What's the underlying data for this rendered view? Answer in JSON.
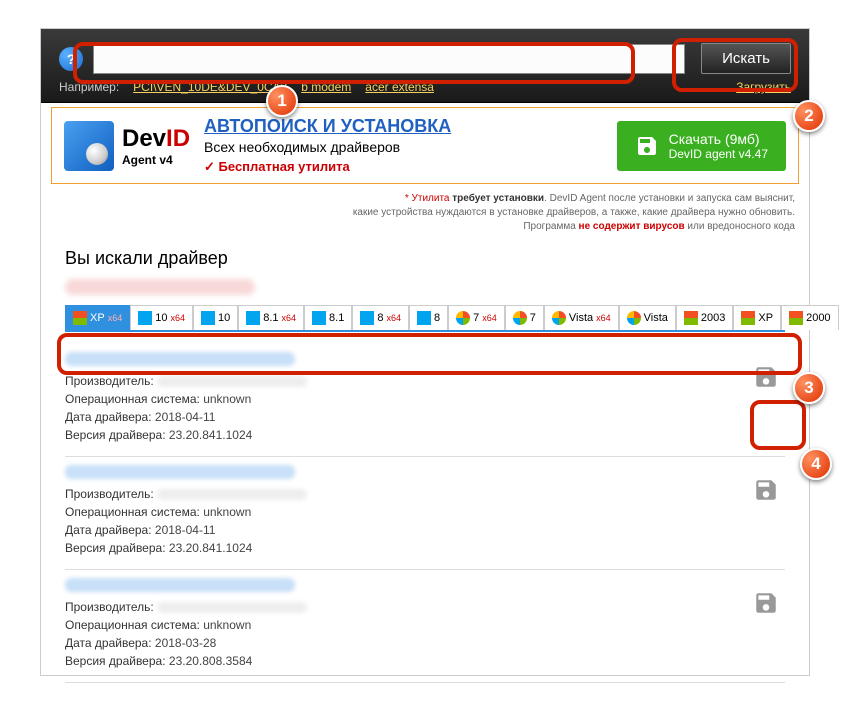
{
  "header": {
    "search_value": "",
    "search_button": "Искать",
    "example_label": "Например:",
    "example_links": [
      "PCI\\VEN_10DE&DEV_0CA3",
      "b modem",
      "acer extensa"
    ],
    "load_link": "Загрузить"
  },
  "promo": {
    "logo_main": "Dev",
    "logo_id": "ID",
    "logo_sub": "Agent v4",
    "title": "АВТОПОИСК И УСТАНОВКА",
    "subtitle": "Всех необходимых драйверов",
    "free": "Бесплатная утилита",
    "download_line1": "Скачать (9мб)",
    "download_line2": "DevID agent v4.47"
  },
  "disclaimer": {
    "l1a": "* Утилита ",
    "l1b": "требует установки",
    "l1c": ". DevID Agent после установки и запуска сам выяснит,",
    "l2": "какие устройства нуждаются в установке драйверов, а также, какие драйвера нужно обновить.",
    "l3a": "Программа ",
    "l3b": "не содержит вирусов",
    "l3c": " или вредоносного кода"
  },
  "content": {
    "heading": "Вы искали драйвер"
  },
  "os_tabs": [
    {
      "label": "XP",
      "sup": "x64",
      "icon": "xp",
      "active": true
    },
    {
      "label": "10",
      "sup": "x64",
      "icon": "w10"
    },
    {
      "label": "10",
      "sup": "",
      "icon": "w10"
    },
    {
      "label": "8.1",
      "sup": "x64",
      "icon": "w8"
    },
    {
      "label": "8.1",
      "sup": "",
      "icon": "w8"
    },
    {
      "label": "8",
      "sup": "x64",
      "icon": "w8"
    },
    {
      "label": "8",
      "sup": "",
      "icon": "w8"
    },
    {
      "label": "7",
      "sup": "x64",
      "icon": "w7"
    },
    {
      "label": "7",
      "sup": "",
      "icon": "w7"
    },
    {
      "label": "Vista",
      "sup": "x64",
      "icon": "w7"
    },
    {
      "label": "Vista",
      "sup": "",
      "icon": "w7"
    },
    {
      "label": "2003",
      "sup": "",
      "icon": "xp"
    },
    {
      "label": "XP",
      "sup": "",
      "icon": "xp"
    },
    {
      "label": "2000",
      "sup": "",
      "icon": "xp"
    }
  ],
  "labels": {
    "manufacturer": "Производитель:",
    "os": "Операционная система:",
    "date": "Дата драйвера:",
    "version": "Версия драйвера:"
  },
  "results": [
    {
      "os": "unknown",
      "date": "2018-04-11",
      "version": "23.20.841.1024"
    },
    {
      "os": "unknown",
      "date": "2018-04-11",
      "version": "23.20.841.1024"
    },
    {
      "os": "unknown",
      "date": "2018-03-28",
      "version": "23.20.808.3584"
    }
  ],
  "callouts": [
    "1",
    "2",
    "3",
    "4"
  ]
}
